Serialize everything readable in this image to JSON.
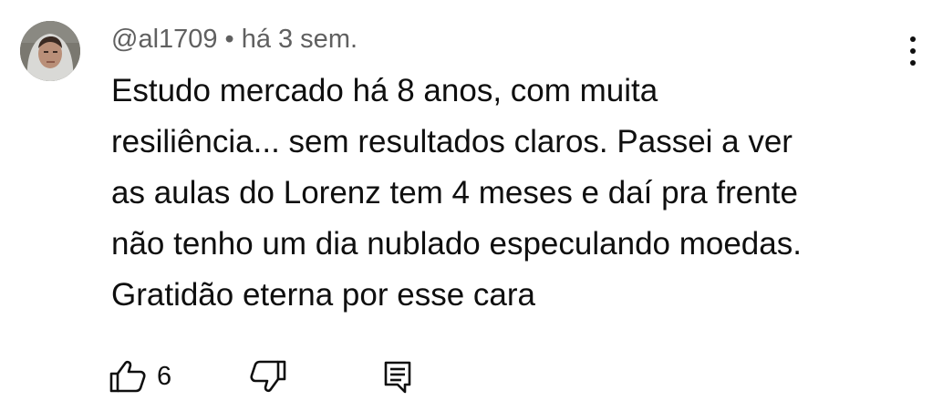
{
  "comment": {
    "author": "@al1709",
    "separator": "•",
    "time": "há 3 sem.",
    "lines": [
      "Estudo mercado há 8 anos, com muita",
      "resiliência... sem resultados claros. Passei a ver",
      "as aulas do Lorenz tem 4 meses e daí pra frente",
      "não tenho um dia nublado especulando moedas.",
      "Gratidão eterna por esse cara"
    ],
    "like_count": "6"
  },
  "icons": {
    "avatar": "avatar",
    "like": "thumbs-up-icon",
    "dislike": "thumbs-down-icon",
    "reply": "reply-comment-icon",
    "menu": "more-vertical-icon"
  },
  "colors": {
    "text": "#0f0f0f",
    "meta": "#606060",
    "background": "#ffffff"
  }
}
